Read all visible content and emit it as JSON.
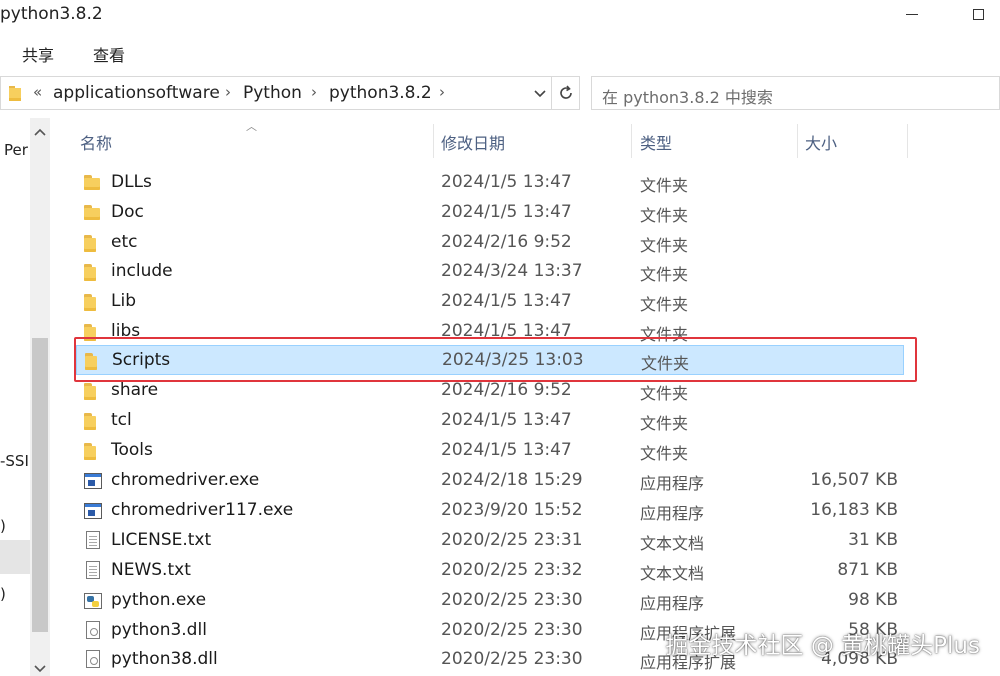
{
  "window": {
    "title": "python3.8.2"
  },
  "ribbon": {
    "tabs": [
      "共享",
      "查看"
    ]
  },
  "address": {
    "overflow": "«",
    "parts": [
      "applicationsoftware",
      "Python",
      "python3.8.2"
    ]
  },
  "search": {
    "placeholder": "在 python3.8.2 中搜索"
  },
  "nav": {
    "items": [
      "Per",
      "-SSI",
      ")",
      ")"
    ]
  },
  "columns": {
    "name": "名称",
    "date": "修改日期",
    "type": "类型",
    "size": "大小"
  },
  "rows": [
    {
      "name": "DLLs",
      "date": "2024/1/5 13:47",
      "type": "文件夹",
      "size": "",
      "icon": "folder-icon"
    },
    {
      "name": "Doc",
      "date": "2024/1/5 13:47",
      "type": "文件夹",
      "size": "",
      "icon": "folder-icon"
    },
    {
      "name": "etc",
      "date": "2024/2/16 9:52",
      "type": "文件夹",
      "size": "",
      "icon": "folder-icon"
    },
    {
      "name": "include",
      "date": "2024/3/24 13:37",
      "type": "文件夹",
      "size": "",
      "icon": "folder-icon"
    },
    {
      "name": "Lib",
      "date": "2024/1/5 13:47",
      "type": "文件夹",
      "size": "",
      "icon": "folder-icon"
    },
    {
      "name": "libs",
      "date": "2024/1/5 13:47",
      "type": "文件夹",
      "size": "",
      "icon": "folder-icon"
    },
    {
      "name": "Scripts",
      "date": "2024/3/25 13:03",
      "type": "文件夹",
      "size": "",
      "icon": "folder-icon",
      "selected": true
    },
    {
      "name": "share",
      "date": "2024/2/16 9:52",
      "type": "文件夹",
      "size": "",
      "icon": "folder-icon"
    },
    {
      "name": "tcl",
      "date": "2024/1/5 13:47",
      "type": "文件夹",
      "size": "",
      "icon": "folder-icon"
    },
    {
      "name": "Tools",
      "date": "2024/1/5 13:47",
      "type": "文件夹",
      "size": "",
      "icon": "folder-icon"
    },
    {
      "name": "chromedriver.exe",
      "date": "2024/2/18 15:29",
      "type": "应用程序",
      "size": "16,507 KB",
      "icon": "exe-icon"
    },
    {
      "name": "chromedriver117.exe",
      "date": "2023/9/20 15:52",
      "type": "应用程序",
      "size": "16,183 KB",
      "icon": "exe-icon"
    },
    {
      "name": "LICENSE.txt",
      "date": "2020/2/25 23:31",
      "type": "文本文档",
      "size": "31 KB",
      "icon": "text-file-icon"
    },
    {
      "name": "NEWS.txt",
      "date": "2020/2/25 23:32",
      "type": "文本文档",
      "size": "871 KB",
      "icon": "text-file-icon"
    },
    {
      "name": "python.exe",
      "date": "2020/2/25 23:30",
      "type": "应用程序",
      "size": "98 KB",
      "icon": "python-icon"
    },
    {
      "name": "python3.dll",
      "date": "2020/2/25 23:30",
      "type": "应用程序扩展",
      "size": "58 KB",
      "icon": "dll-icon"
    },
    {
      "name": "python38.dll",
      "date": "2020/2/25 23:30",
      "type": "应用程序扩展",
      "size": "4,098 KB",
      "icon": "dll-icon"
    }
  ],
  "watermark": "掘金技术社区 @ 黄桃罐头Plus"
}
